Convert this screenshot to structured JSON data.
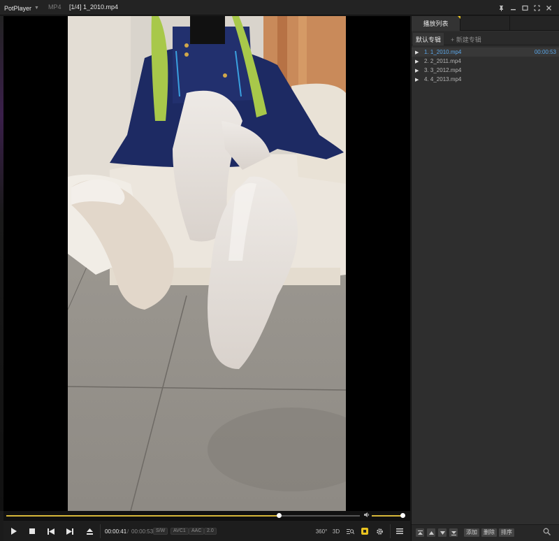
{
  "window": {
    "app_name": "PotPlayer",
    "format": "MP4",
    "title": "[1/4] 1_2010.mp4"
  },
  "controls": {
    "current_time": "00:00:41",
    "slash": "/",
    "total_time": "00:00:53",
    "badges": [
      "S/W",
      "AVC1",
      "AAC",
      "2.0"
    ],
    "right_buttons": [
      "360°",
      "3D"
    ],
    "seek_progress": 0.77,
    "volume_level": 1.0
  },
  "playlist": {
    "tab_label": "播放列表",
    "album_tab": "默认专辑",
    "album_new": "+ 新建专辑",
    "items": [
      {
        "name": "1. 1_2010.mp4",
        "duration": "00:00:53",
        "current": true
      },
      {
        "name": "2. 2_2011.mp4",
        "duration": "",
        "current": false
      },
      {
        "name": "3. 3_2012.mp4",
        "duration": "",
        "current": false
      },
      {
        "name": "4. 4_2013.mp4",
        "duration": "",
        "current": false
      }
    ],
    "footer": {
      "add": "添加",
      "delete": "删除",
      "sort": "排序"
    }
  },
  "colors": {
    "accent": "#e8c21f",
    "selection_text": "#5aa6e8"
  },
  "icons": {
    "window": [
      "pin-icon",
      "minimize-icon",
      "maximize-icon",
      "fullscreen-icon",
      "close-icon"
    ],
    "playback": [
      "play-icon",
      "stop-icon",
      "previous-icon",
      "next-icon",
      "eject-icon",
      "volume-icon",
      "capture-icon",
      "settings-icon",
      "menu-icon"
    ],
    "playlist_footer": [
      "move-top-icon",
      "move-up-icon",
      "move-down-icon",
      "move-bottom-icon",
      "search-icon"
    ]
  }
}
